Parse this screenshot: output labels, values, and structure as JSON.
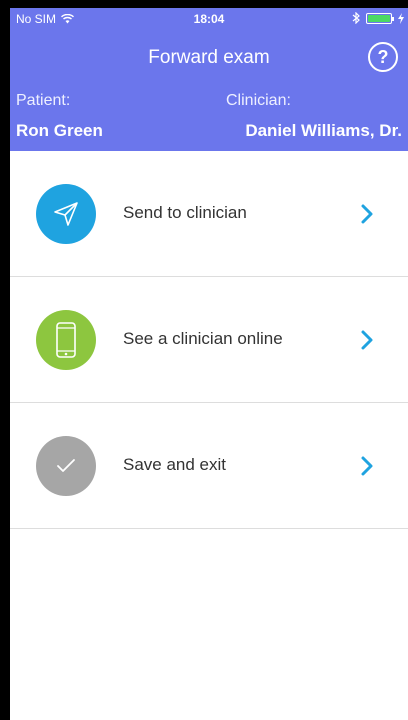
{
  "status_bar": {
    "carrier": "No SIM",
    "time": "18:04"
  },
  "header": {
    "title": "Forward exam",
    "help_label": "?",
    "patient_label": "Patient:",
    "patient_name": "Ron Green",
    "clinician_label": "Clinician:",
    "clinician_name": "Daniel Williams, Dr."
  },
  "menu": {
    "items": [
      {
        "label": "Send to clinician",
        "icon": "paper-plane-icon",
        "color": "#1fa3e0"
      },
      {
        "label": "See a clinician online",
        "icon": "smartphone-icon",
        "color": "#8dc63f"
      },
      {
        "label": "Save and exit",
        "icon": "checkmark-icon",
        "color": "#a6a6a6"
      }
    ]
  },
  "colors": {
    "header": "#6b76ec",
    "chevron": "#1fa3e0"
  }
}
